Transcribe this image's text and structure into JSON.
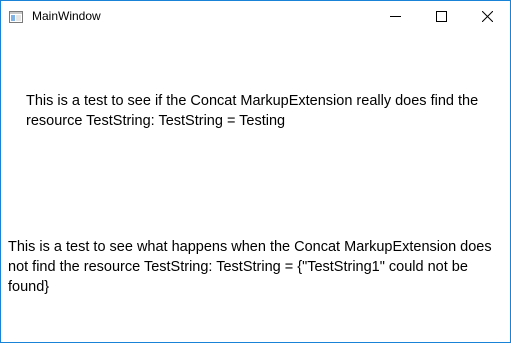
{
  "window": {
    "title": "MainWindow",
    "accent_color": "#1883d7",
    "icon": "window-app-icon"
  },
  "caption_buttons": {
    "minimize_icon": "minimize-icon",
    "maximize_icon": "maximize-icon",
    "close_icon": "close-icon"
  },
  "content": {
    "block1": {
      "line1": "This is a test to see if the Concat MarkupExtension really does find the",
      "line2": "resource TestString: TestString =  Testing"
    },
    "block2": {
      "line1": "This is a test to see what happens when the  Concat MarkupExtension does",
      "line2": "not find the resource TestString: TestString =  {\"TestString1\" could not be",
      "line3": "found}"
    }
  }
}
